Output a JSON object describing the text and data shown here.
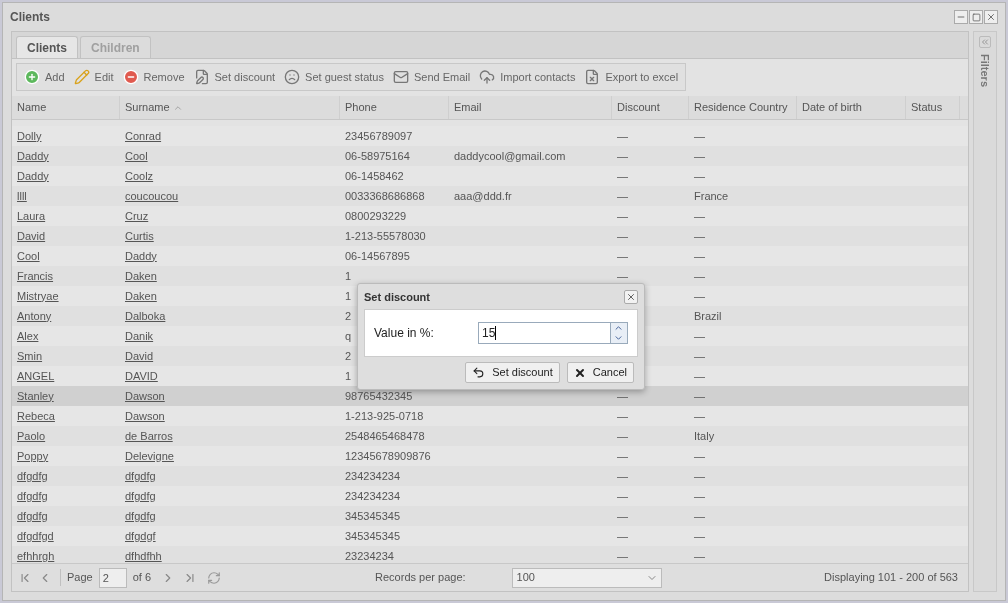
{
  "window": {
    "title": "Clients"
  },
  "tabs": [
    {
      "label": "Clients",
      "selected": true
    },
    {
      "label": "Children",
      "selected": false
    }
  ],
  "toolbar": [
    {
      "label": "Add",
      "kind": "add"
    },
    {
      "label": "Edit",
      "kind": "edit"
    },
    {
      "label": "Remove",
      "kind": "remove"
    },
    {
      "label": "Set discount",
      "kind": "discount"
    },
    {
      "label": "Set guest status",
      "kind": "guest"
    },
    {
      "label": "Send Email",
      "kind": "email"
    },
    {
      "label": "Import contacts",
      "kind": "import"
    },
    {
      "label": "Export to excel",
      "kind": "export"
    }
  ],
  "table": {
    "columns": [
      {
        "label": "Name",
        "sorted": false
      },
      {
        "label": "Surname",
        "sorted": true
      },
      {
        "label": "Phone",
        "sorted": false
      },
      {
        "label": "Email",
        "sorted": false
      },
      {
        "label": "Discount",
        "sorted": false
      },
      {
        "label": "Residence Country",
        "sorted": false
      },
      {
        "label": "Date of birth",
        "sorted": false
      },
      {
        "label": "Status",
        "sorted": false
      }
    ],
    "rows": [
      {
        "name": "Dolly",
        "surname": "Conrad",
        "phone": "23456789097",
        "email": "",
        "discount": "—",
        "country": "—",
        "selected": false
      },
      {
        "name": "Daddy",
        "surname": "Cool",
        "phone": "06-58975164",
        "email": "daddycool@gmail.com",
        "discount": "—",
        "country": "—",
        "selected": false
      },
      {
        "name": "Daddy",
        "surname": "Coolz",
        "phone": "06-1458462",
        "email": "",
        "discount": "—",
        "country": "—",
        "selected": false
      },
      {
        "name": "llll",
        "surname": "coucoucou",
        "phone": "0033368686868",
        "email": "aaa@ddd.fr",
        "discount": "—",
        "country": "France",
        "selected": false
      },
      {
        "name": "Laura",
        "surname": "Cruz",
        "phone": "0800293229",
        "email": "",
        "discount": "—",
        "country": "—",
        "selected": false
      },
      {
        "name": "David",
        "surname": "Curtis",
        "phone": "1-213-55578030",
        "email": "",
        "discount": "—",
        "country": "—",
        "selected": false
      },
      {
        "name": "Cool",
        "surname": "Daddy",
        "phone": "06-14567895",
        "email": "",
        "discount": "—",
        "country": "—",
        "selected": false
      },
      {
        "name": "Francis",
        "surname": "Daken",
        "phone": "1",
        "email": "",
        "discount": "—",
        "country": "—",
        "selected": false
      },
      {
        "name": "Mistryae",
        "surname": "Daken",
        "phone": "1",
        "email": "",
        "discount": "",
        "country": "—",
        "selected": false
      },
      {
        "name": "Antony",
        "surname": "Dalboka",
        "phone": "2",
        "email": "",
        "discount": "",
        "country": "Brazil",
        "selected": false
      },
      {
        "name": "Alex",
        "surname": "Danik",
        "phone": "q",
        "email": "",
        "discount": "",
        "country": "—",
        "selected": false
      },
      {
        "name": "Smin",
        "surname": "David",
        "phone": "2",
        "email": "",
        "discount": "",
        "country": "—",
        "selected": false
      },
      {
        "name": "ANGEL",
        "surname": "DAVID",
        "phone": "1",
        "email": "",
        "discount": "",
        "country": "—",
        "selected": false
      },
      {
        "name": "Stanley",
        "surname": "Dawson",
        "phone": "98765432345",
        "email": "",
        "discount": "—",
        "country": "—",
        "selected": true
      },
      {
        "name": "Rebeca",
        "surname": "Dawson",
        "phone": "1-213-925-0718",
        "email": "",
        "discount": "—",
        "country": "—",
        "selected": false
      },
      {
        "name": "Paolo",
        "surname": "de Barros",
        "phone": "2548465468478",
        "email": "",
        "discount": "—",
        "country": "Italy",
        "selected": false
      },
      {
        "name": "Poppy",
        "surname": "Delevigne",
        "phone": "12345678909876",
        "email": "",
        "discount": "—",
        "country": "—",
        "selected": false
      },
      {
        "name": "dfgdfg",
        "surname": "dfgdfg",
        "phone": "234234234",
        "email": "",
        "discount": "—",
        "country": "—",
        "selected": false
      },
      {
        "name": "dfgdfg",
        "surname": "dfgdfg",
        "phone": "234234234",
        "email": "",
        "discount": "—",
        "country": "—",
        "selected": false
      },
      {
        "name": "dfgdfg",
        "surname": "dfgdfg",
        "phone": "345345345",
        "email": "",
        "discount": "—",
        "country": "—",
        "selected": false
      },
      {
        "name": "dfgdfgd",
        "surname": "dfgdgf",
        "phone": "345345345",
        "email": "",
        "discount": "—",
        "country": "—",
        "selected": false
      },
      {
        "name": "efhhrgh",
        "surname": "dfhdfhh",
        "phone": "23234234",
        "email": "",
        "discount": "—",
        "country": "—",
        "selected": false
      }
    ]
  },
  "filters_panel": {
    "title": "Filters",
    "expanded": false
  },
  "pager": {
    "page_label": "Page",
    "page": "2",
    "of": "of 6",
    "records_label": "Records per page:",
    "per_page": "100",
    "display": "Displaying 101 - 200 of 563"
  },
  "dialog": {
    "title": "Set discount",
    "field_label": "Value in %:",
    "value": "15",
    "buttons": [
      {
        "label": "Set discount",
        "kind": "confirm"
      },
      {
        "label": "Cancel",
        "kind": "cancel"
      }
    ]
  }
}
